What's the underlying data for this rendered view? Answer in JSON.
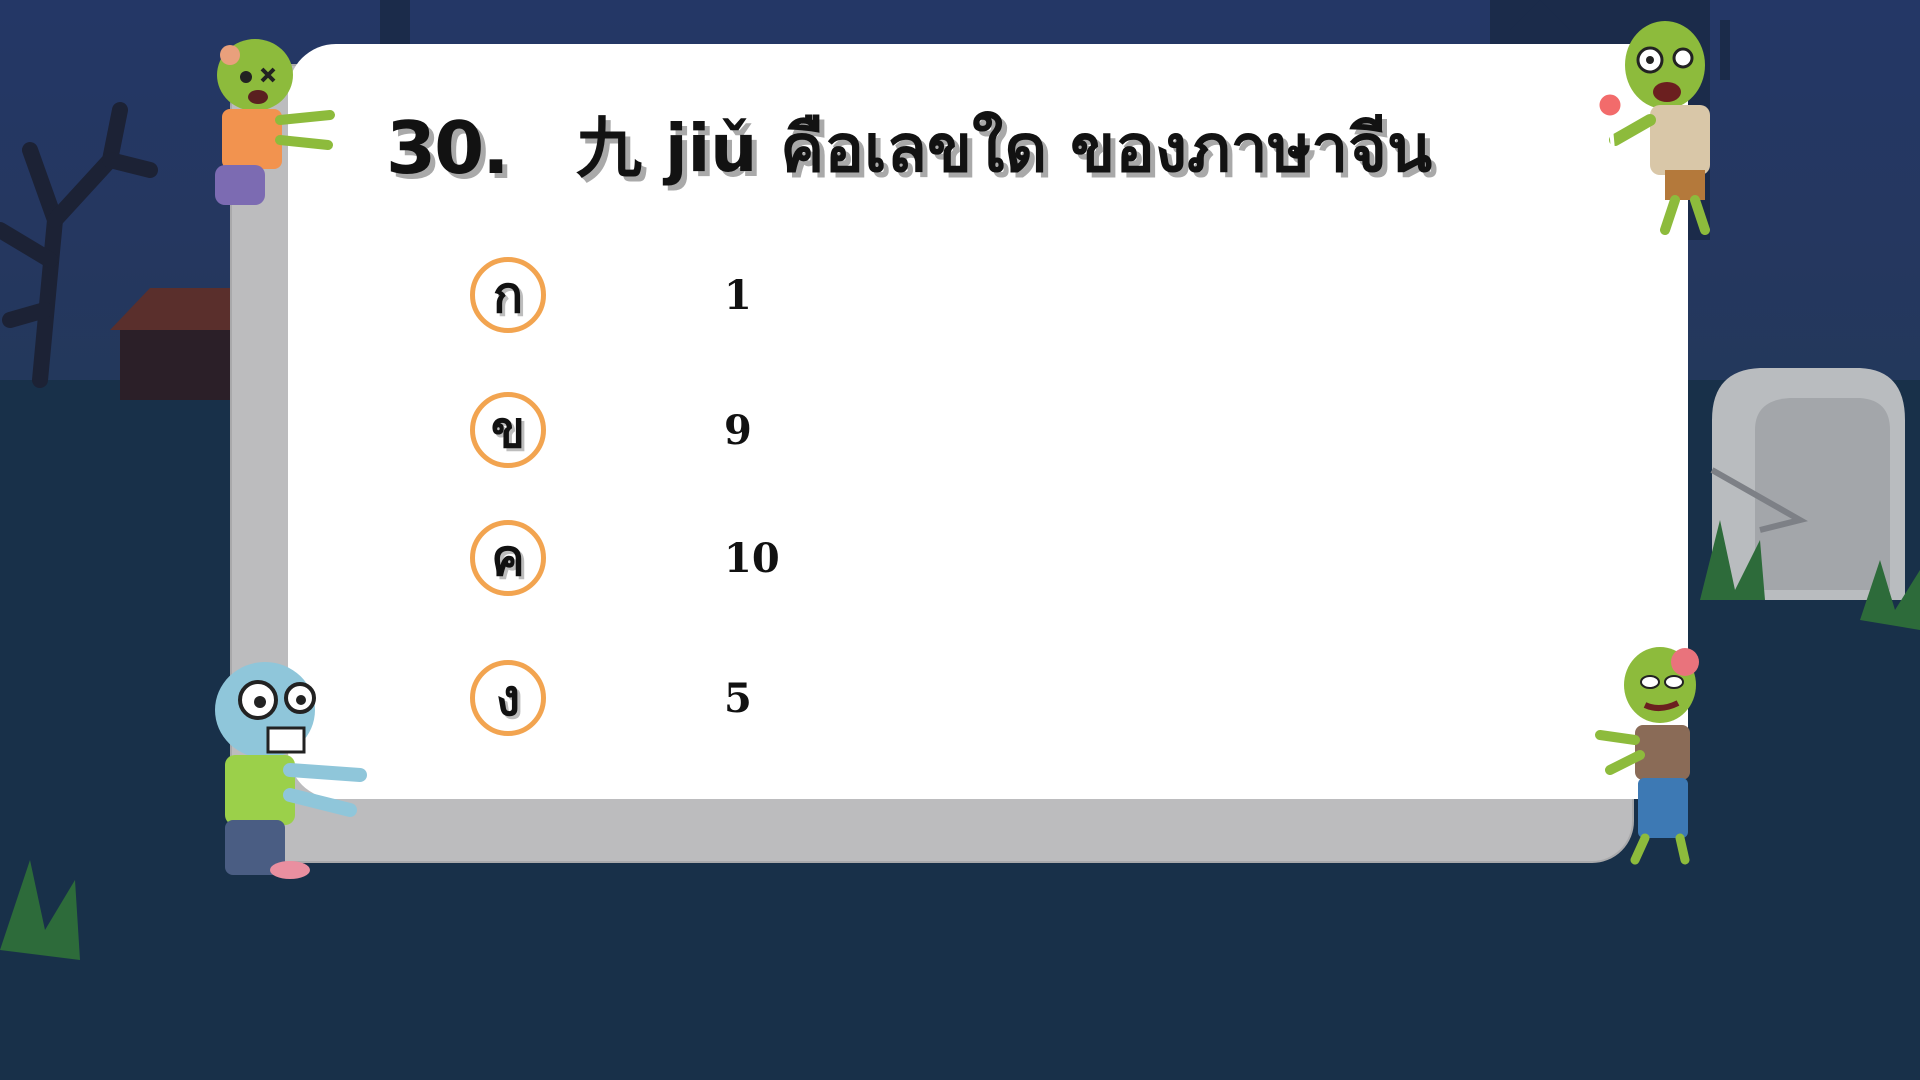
{
  "question": {
    "number": "30.",
    "text": "九 jiǔ คือเลขใด ของภาษาจีน"
  },
  "options": [
    {
      "letter": "ก",
      "value": "1"
    },
    {
      "letter": "ข",
      "value": "9"
    },
    {
      "letter": "ค",
      "value": "10"
    },
    {
      "letter": "ง",
      "value": "5"
    }
  ],
  "colors": {
    "sky": "#243766",
    "ground": "#183049",
    "card": "#ffffff",
    "card_shadow": "#bcbcbe",
    "badge_ring": "#f2a450"
  },
  "decorations": [
    "zombie-top-left",
    "zombie-top-right",
    "zombie-bottom-left",
    "zombie-bottom-right",
    "gravestone",
    "dead-tree",
    "grass"
  ]
}
